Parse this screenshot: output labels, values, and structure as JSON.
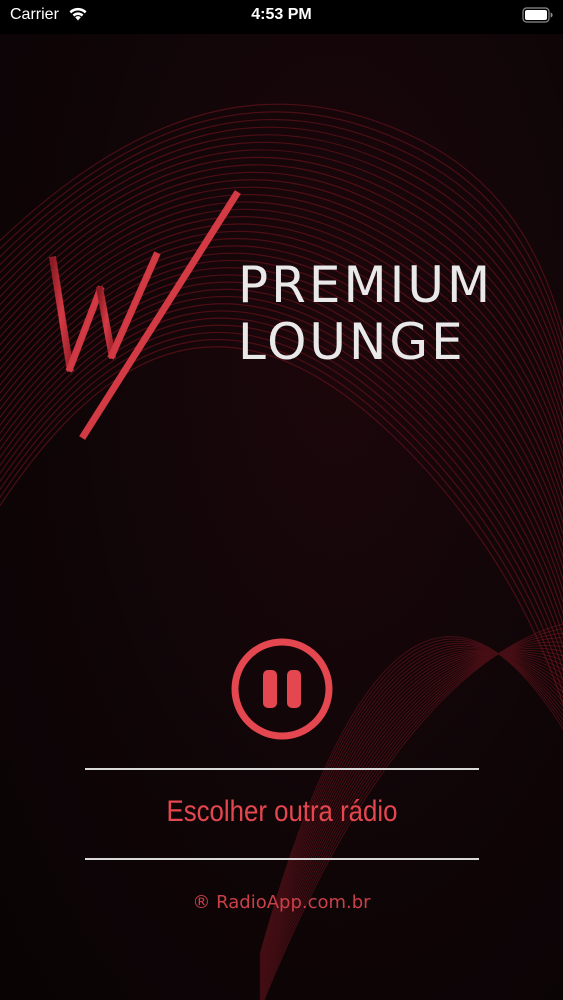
{
  "status_bar": {
    "carrier": "Carrier",
    "time": "4:53 PM",
    "wifi_icon": "wifi-icon",
    "battery_icon": "battery-full-icon"
  },
  "brand": {
    "line1": "PREMIUM",
    "line2": "LOUNGE",
    "mark_icon": "w-slash-logo",
    "text_color": "#e9e9ea",
    "mark_color": "#c8323c"
  },
  "player": {
    "control_icon": "pause-icon",
    "accent_color": "#e4474f"
  },
  "actions": {
    "choose_radio_label": "Escolher outra rádio"
  },
  "footer": {
    "credit": "® RadioApp.com.br"
  }
}
